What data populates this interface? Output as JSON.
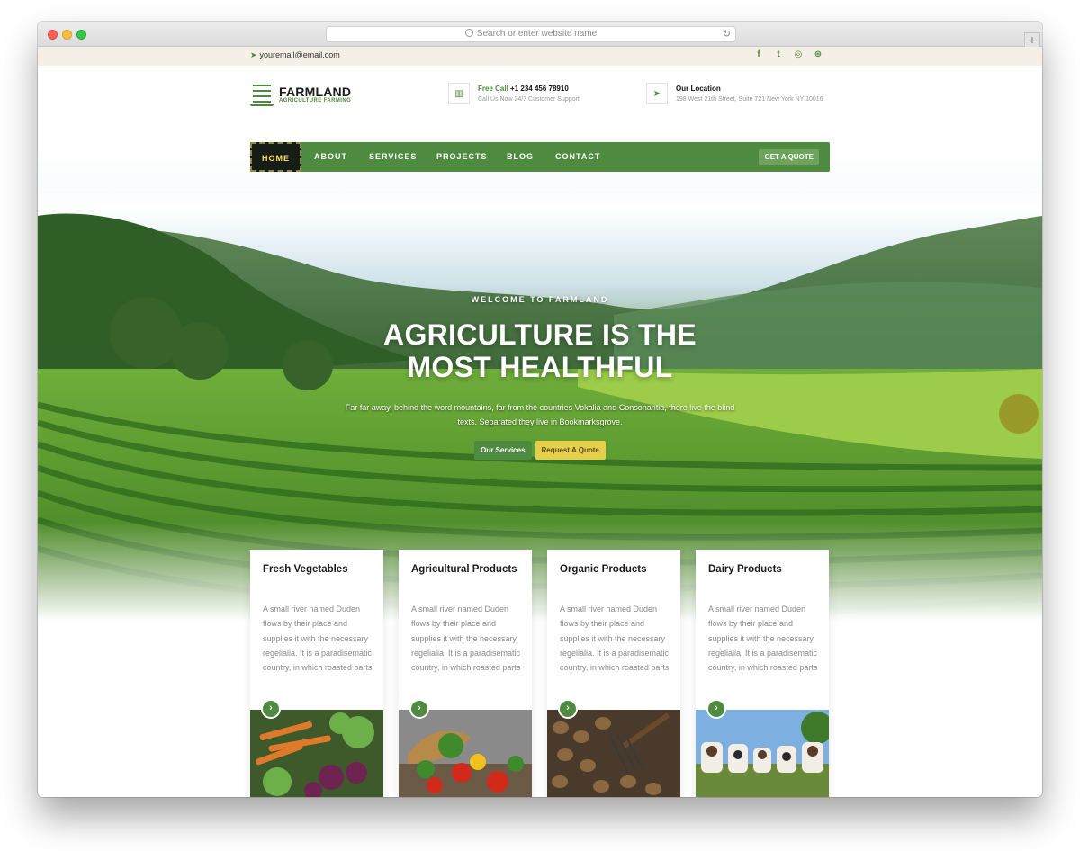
{
  "browser": {
    "url_placeholder": "Search or enter website name",
    "reload_glyph": "↻",
    "new_tab_glyph": "+"
  },
  "topbar": {
    "email": "youremail@email.com",
    "email_icon": "paper-plane-icon",
    "socials": [
      {
        "name": "facebook-icon",
        "glyph": "f"
      },
      {
        "name": "twitter-icon",
        "glyph": "t"
      },
      {
        "name": "instagram-icon",
        "glyph": "◎"
      },
      {
        "name": "dribbble-icon",
        "glyph": "⊛"
      }
    ]
  },
  "header": {
    "logo_title": "FARMLAND",
    "logo_subtitle": "AGRICULTURE FARMING",
    "call_label": "Free Call",
    "call_number": "+1 234 456 78910",
    "call_sub": "Call Us Now 24/7 Customer Support",
    "call_icon": "map-icon",
    "location_label": "Our Location",
    "location_address": "198 West 21th Street, Suite 721 New York NY 10016",
    "location_icon": "paper-plane-icon"
  },
  "nav": {
    "items": [
      "HOME",
      "ABOUT",
      "SERVICES",
      "PROJECTS",
      "BLOG",
      "CONTACT"
    ],
    "quote": "GET A QUOTE"
  },
  "hero": {
    "welcome": "WELCOME TO FARMLAND",
    "headline_line1": "AGRICULTURE IS THE",
    "headline_line2": "MOST HEALTHFUL",
    "description": "Far far away, behind the word mountains, far from the countries Vokalia and Consonantia, there live the blind texts. Separated they live in Bookmarksgrove.",
    "btn_services": "Our Services",
    "btn_quote": "Request A Quote"
  },
  "cards": [
    {
      "title": "Fresh Vegetables",
      "text": "A small river named Duden flows by their place and supplies it with the necessary regelialia. It is a paradisematic country, in which roasted parts"
    },
    {
      "title": "Agricultural Products",
      "text": "A small river named Duden flows by their place and supplies it with the necessary regelialia. It is a paradisematic country, in which roasted parts"
    },
    {
      "title": "Organic Products",
      "text": "A small river named Duden flows by their place and supplies it with the necessary regelialia. It is a paradisematic country, in which roasted parts"
    },
    {
      "title": "Dairy Products",
      "text": "A small river named Duden flows by their place and supplies it with the necessary regelialia. It is a paradisematic country, in which roasted parts"
    }
  ],
  "colors": {
    "brand_green": "#4f8a41",
    "nav_active_bg": "#151d16",
    "nav_active_text": "#ffdd55",
    "accent_yellow": "#e6cf4a"
  }
}
